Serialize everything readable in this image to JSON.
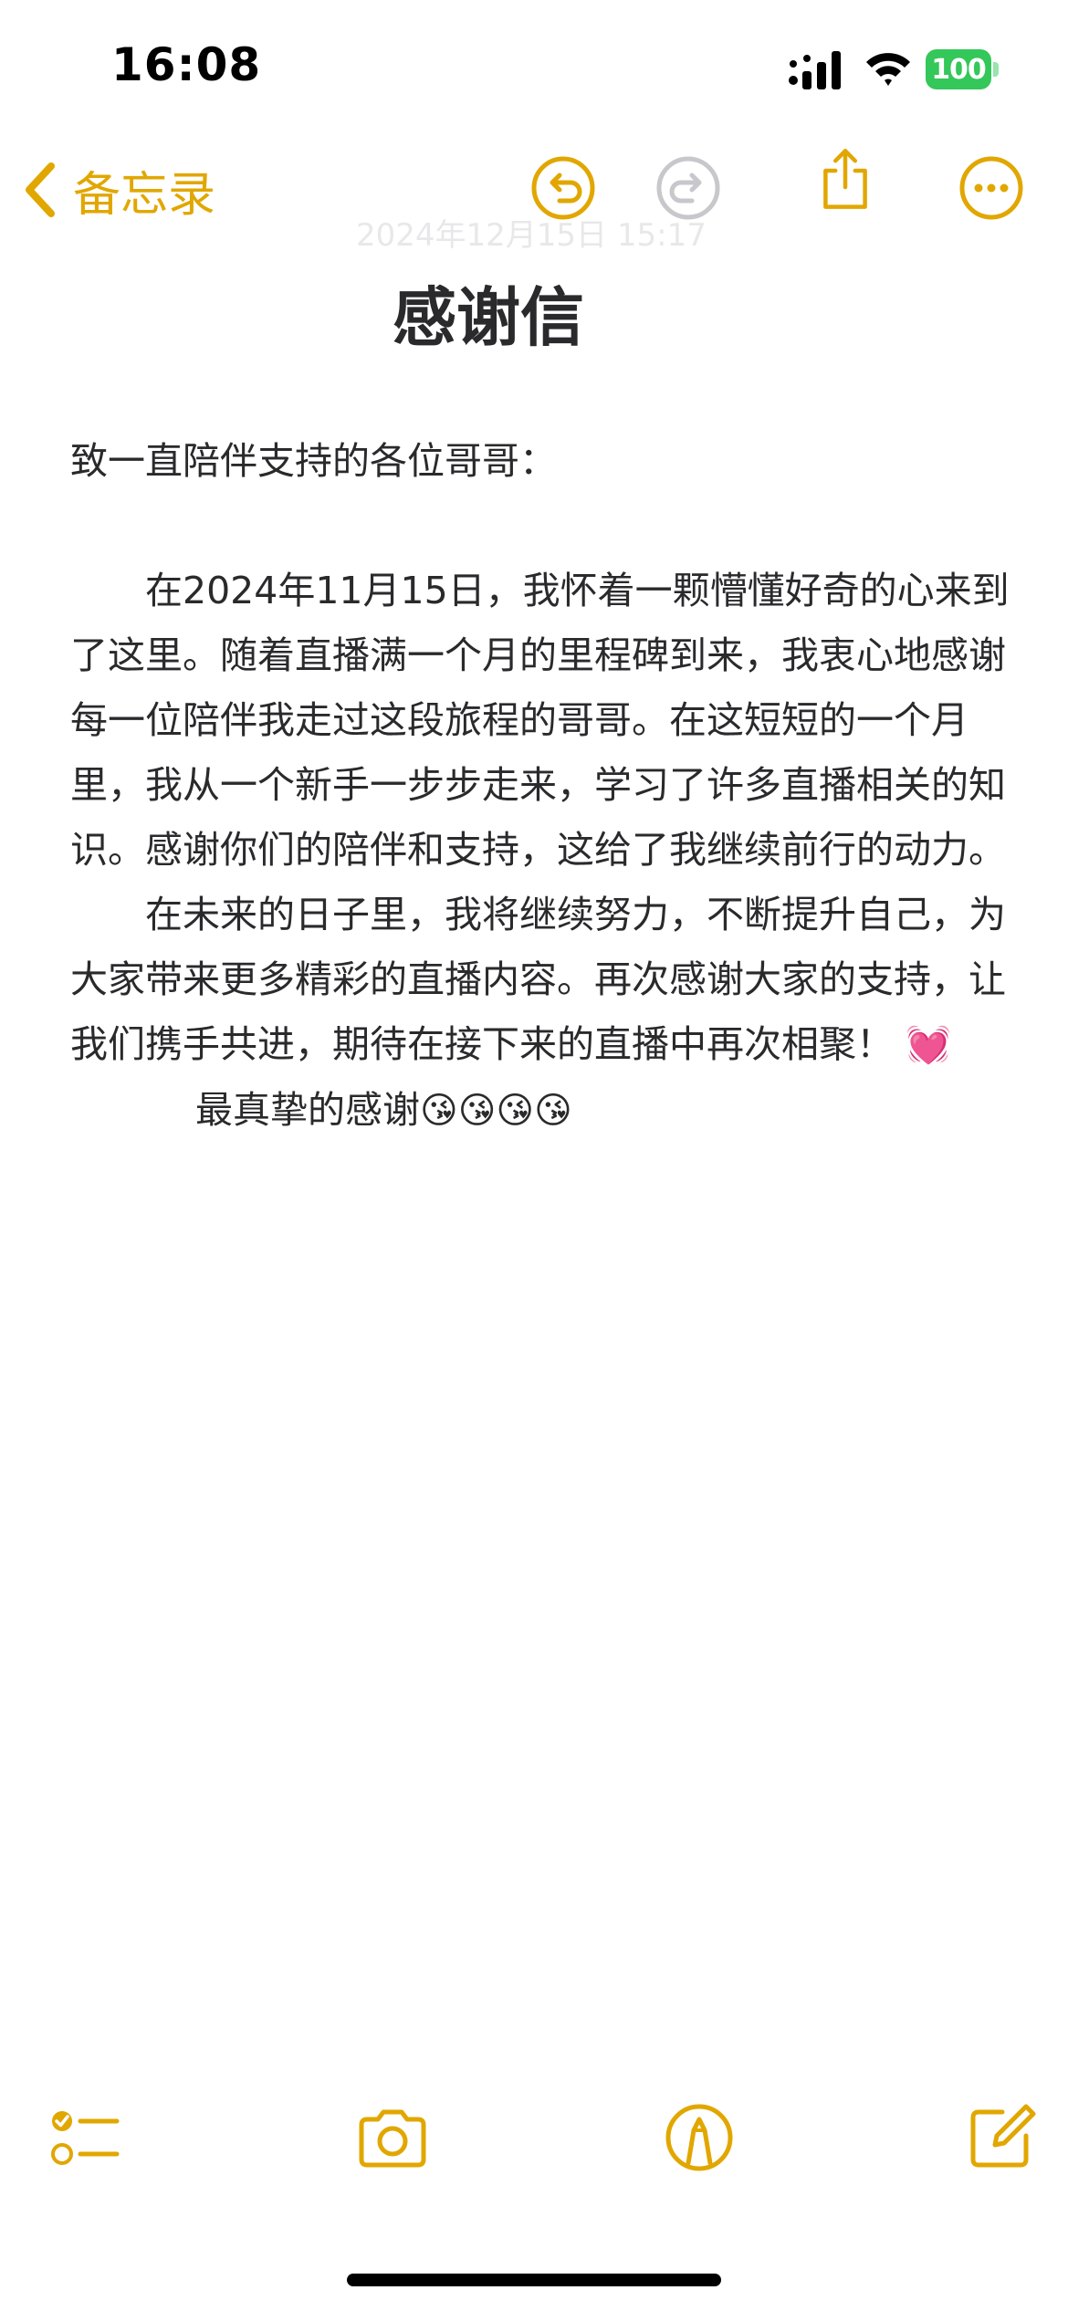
{
  "status_bar": {
    "time": "16:08",
    "battery": "100",
    "battery_color": "#34c759"
  },
  "nav": {
    "back_label": "备忘录",
    "accent_color": "#e1a700",
    "icons": [
      "chevron-left-icon",
      "undo-icon",
      "redo-icon",
      "share-icon",
      "more-icon"
    ]
  },
  "note": {
    "ghost_date": "2024年12月15日 15:17",
    "title": "感谢信",
    "greeting": "致一直陪伴支持的各位哥哥：",
    "paragraph1": "在2024年11月15日，我怀着一颗懵懂好奇的心来到了这里。随着直播满一个月的里程碑到来，我衷心地感谢每一位陪伴我走过这段旅程的哥哥。在这短短的一个月里，我从一个新手一步步走来，学习了许多直播相关的知识。感谢你们的陪伴和支持，这给了我继续前行的动力。",
    "paragraph2": "在未来的日子里，我将继续努力，不断提升自己，为大家带来更多精彩的直播内容。再次感谢大家的支持，让我们携手共进，期待在接下来的直播中再次相聚！",
    "paragraph2_emoji": "💓",
    "closing": "最真挚的感谢",
    "closing_emoji": "😘😘😘😘"
  },
  "toolbar": {
    "icons": [
      "checklist-icon",
      "camera-icon",
      "markup-icon",
      "compose-icon"
    ]
  }
}
